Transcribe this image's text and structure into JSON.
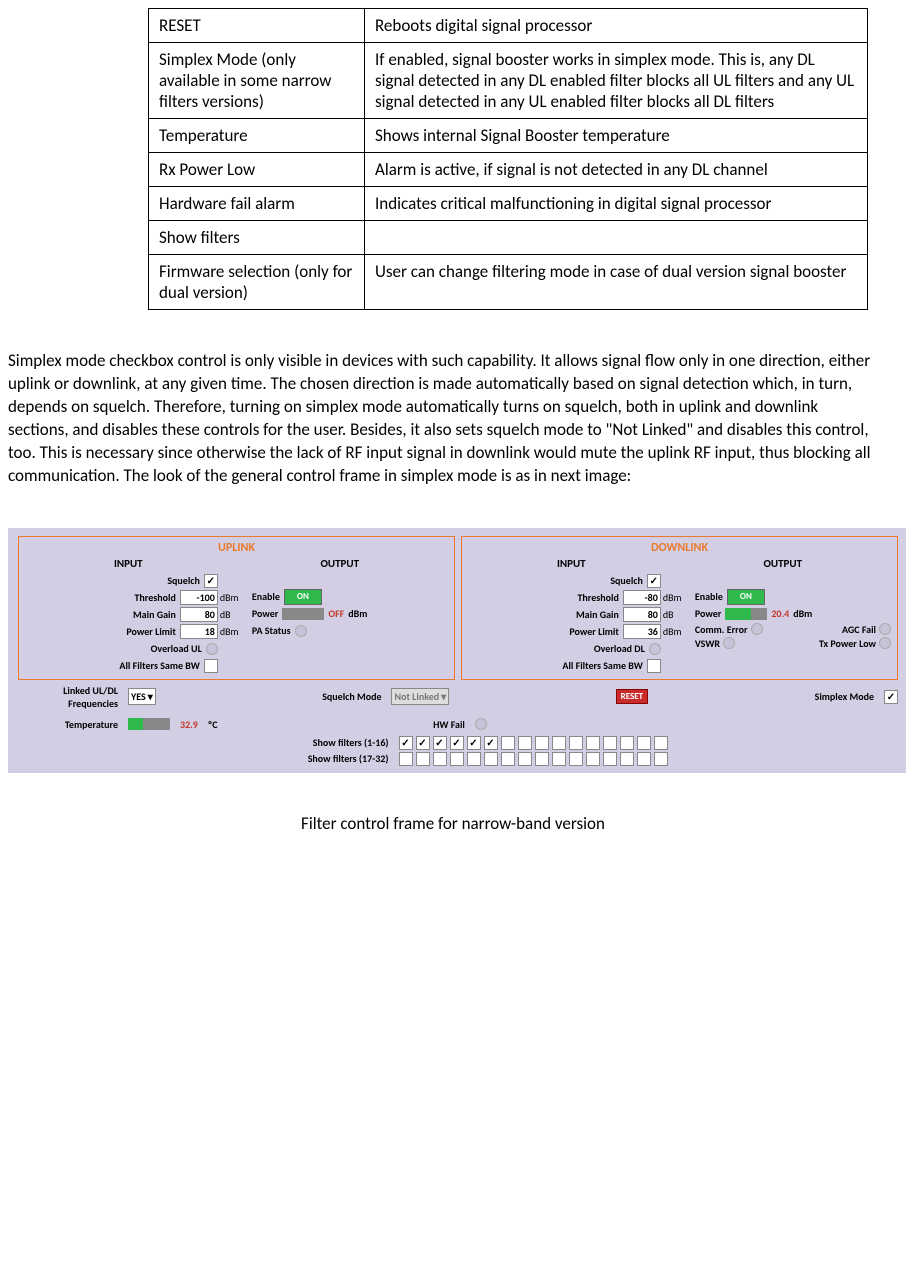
{
  "table": {
    "rows": [
      {
        "k": "RESET",
        "v": "Reboots digital signal processor"
      },
      {
        "k": "Simplex Mode (only available in some narrow filters versions)",
        "v": "If enabled, signal booster works in simplex mode. This is, any DL signal detected in any DL enabled filter blocks all UL filters and any UL signal detected in any UL enabled filter blocks all DL filters"
      },
      {
        "k": "Temperature",
        "v": "Shows internal Signal Booster temperature"
      },
      {
        "k": "Rx Power Low",
        "v": "Alarm is active, if signal is not detected in any DL channel"
      },
      {
        "k": "Hardware fail alarm",
        "v": "Indicates critical malfunctioning in digital signal processor"
      },
      {
        "k": "Show filters",
        "v": ""
      },
      {
        "k": "Firmware selection (only for dual version)",
        "v": "User can change filtering mode in case of dual version signal booster"
      }
    ]
  },
  "paragraph": "Simplex mode checkbox control is only visible in devices with such capability. It allows signal flow only in one direction, either uplink or downlink, at any given time. The chosen direction is made automatically based on signal detection which, in turn, depends on squelch. Therefore, turning on simplex mode automatically turns on squelch, both in uplink and downlink sections, and disables these controls for the user. Besides, it also sets squelch mode to \"Not Linked\" and disables this control, too. This is necessary since otherwise the lack of RF input signal in downlink would mute the uplink RF input, thus blocking all communication. The look of the general control frame in simplex mode is as in next image:",
  "panel": {
    "uplink": {
      "title": "UPLINK",
      "input": "INPUT",
      "output": "OUTPUT",
      "squelch": {
        "label": "Squelch",
        "checked": true
      },
      "threshold": {
        "label": "Threshold",
        "value": "-100",
        "unit": "dBm"
      },
      "main_gain": {
        "label": "Main Gain",
        "value": "80",
        "unit": "dB"
      },
      "power_limit": {
        "label": "Power Limit",
        "value": "18",
        "unit": "dBm"
      },
      "overload": {
        "label": "Overload UL"
      },
      "all_bw": {
        "label": "All Filters Same BW",
        "checked": false
      },
      "out": {
        "enable": {
          "label": "Enable",
          "value": "ON"
        },
        "power": {
          "label": "Power",
          "value": "OFF",
          "unit": "dBm"
        },
        "pa": {
          "label": "PA Status"
        }
      }
    },
    "downlink": {
      "title": "DOWNLINK",
      "input": "INPUT",
      "output": "OUTPUT",
      "squelch": {
        "label": "Squelch",
        "checked": true
      },
      "threshold": {
        "label": "Threshold",
        "value": "-80",
        "unit": "dBm"
      },
      "main_gain": {
        "label": "Main Gain",
        "value": "80",
        "unit": "dB"
      },
      "power_limit": {
        "label": "Power Limit",
        "value": "36",
        "unit": "dBm"
      },
      "overload": {
        "label": "Overload DL"
      },
      "all_bw": {
        "label": "All Filters Same BW",
        "checked": false
      },
      "out": {
        "enable": {
          "label": "Enable",
          "value": "ON"
        },
        "power": {
          "label": "Power",
          "value": "20.4",
          "unit": "dBm"
        },
        "comm": {
          "label": "Comm. Error"
        },
        "agc": {
          "label": "AGC Fail"
        },
        "vswr": {
          "label": "VSWR"
        },
        "txlow": {
          "label": "Tx Power Low"
        }
      }
    },
    "mid": {
      "linked": {
        "label": "Linked UL/DL Frequencies",
        "value": "YES"
      },
      "sqmode": {
        "label": "Squelch Mode",
        "value": "Not Linked"
      },
      "reset": "RESET",
      "simplex": {
        "label": "Simplex Mode",
        "checked": true
      },
      "temp": {
        "label": "Temperature",
        "value": "32.9",
        "unit": "ºC"
      },
      "hwfail": {
        "label": "HW Fail"
      }
    },
    "filters": {
      "r1": {
        "label": "Show filters (1-16)",
        "checked": [
          true,
          true,
          true,
          true,
          true,
          true,
          false,
          false,
          false,
          false,
          false,
          false,
          false,
          false,
          false,
          false
        ]
      },
      "r2": {
        "label": "Show filters (17-32)",
        "checked": [
          false,
          false,
          false,
          false,
          false,
          false,
          false,
          false,
          false,
          false,
          false,
          false,
          false,
          false,
          false,
          false
        ]
      }
    }
  },
  "caption": "Filter control frame for narrow-band version"
}
